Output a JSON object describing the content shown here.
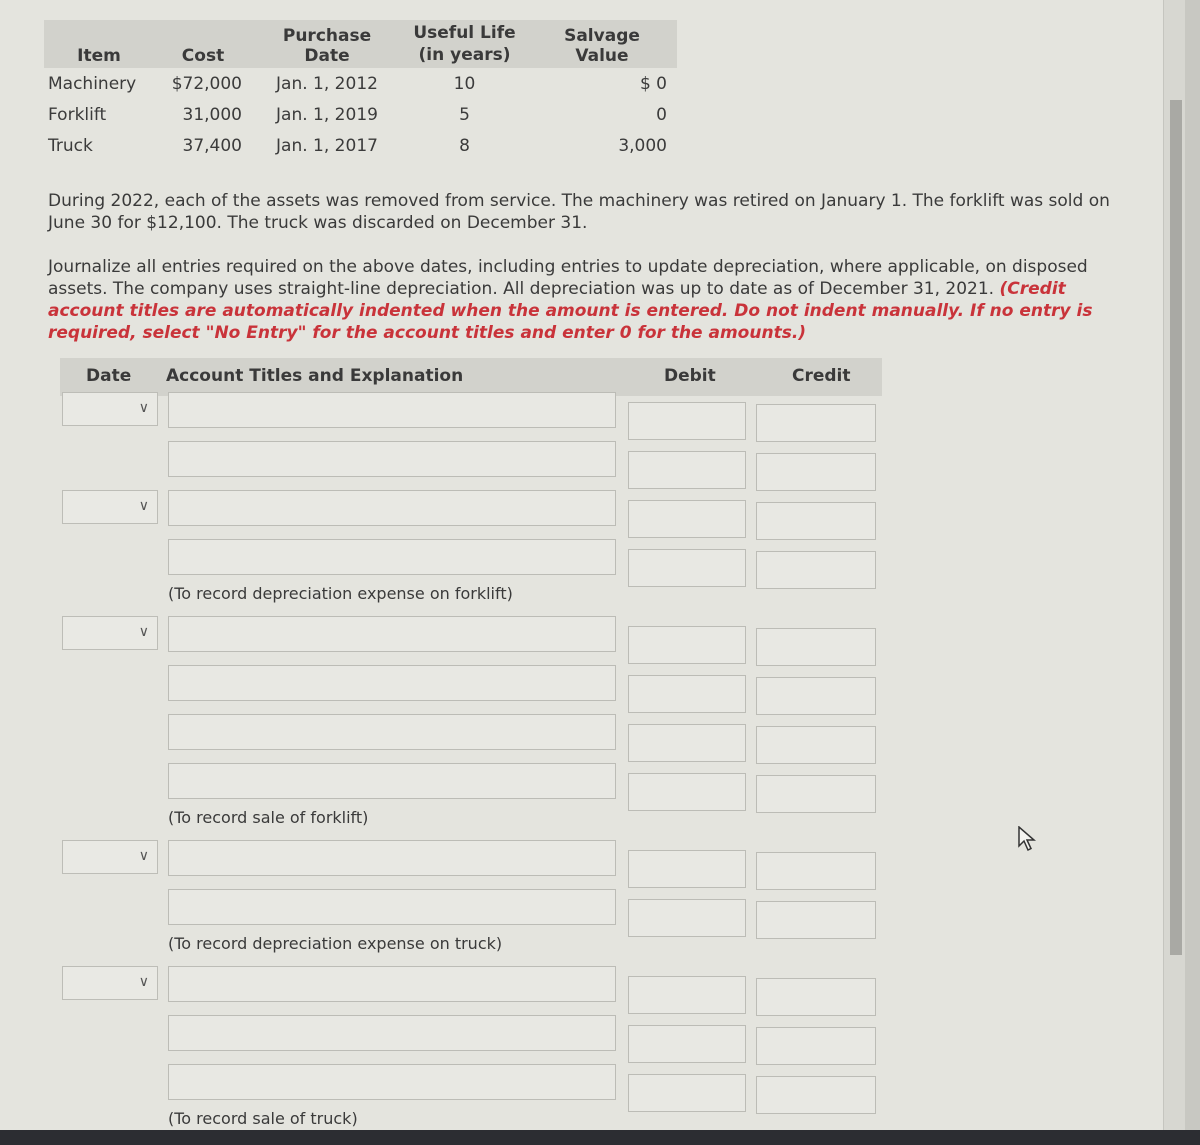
{
  "asset_table": {
    "headers": {
      "item": "Item",
      "cost": "Cost",
      "purchase_date": "Purchase Date",
      "useful_life_line1": "Useful Life",
      "useful_life_line2": "(in years)",
      "salvage_value": "Salvage Value"
    },
    "rows": [
      {
        "item": "Machinery",
        "cost": "$72,000",
        "purchase_date": "Jan. 1, 2012",
        "useful_life": "10",
        "salvage_value": "$ 0"
      },
      {
        "item": "Forklift",
        "cost": "31,000",
        "purchase_date": "Jan. 1, 2019",
        "useful_life": "5",
        "salvage_value": "0"
      },
      {
        "item": "Truck",
        "cost": "37,400",
        "purchase_date": "Jan. 1, 2017",
        "useful_life": "8",
        "salvage_value": "3,000"
      }
    ]
  },
  "paragraphs": {
    "scenario": "During 2022, each of the assets was removed from service. The machinery was retired on January 1. The forklift was sold on June 30 for $12,100. The truck was discarded on December 31.",
    "instruction": "Journalize all entries required on the above dates, including entries to update depreciation, where applicable, on disposed assets. The company uses straight-line depreciation. All depreciation was up to date as of December 31, 2021.",
    "instruction_note": "(Credit account titles are automatically indented when the amount is entered. Do not indent manually. If no entry is required, select \"No Entry\" for the account titles and enter 0 for the amounts.)"
  },
  "journal": {
    "headers": {
      "date": "Date",
      "account": "Account Titles and Explanation",
      "debit": "Debit",
      "credit": "Credit"
    },
    "entries": [
      {
        "date": "",
        "lines": 2,
        "note": ""
      },
      {
        "date": "",
        "lines": 2,
        "note": "(To record depreciation expense on forklift)"
      },
      {
        "date": "",
        "lines": 4,
        "note": "(To record sale of forklift)"
      },
      {
        "date": "",
        "lines": 2,
        "note": "(To record depreciation expense on truck)"
      },
      {
        "date": "",
        "lines": 3,
        "note": "(To record sale of truck)"
      }
    ]
  },
  "icons": {
    "date_chevron": "chevron-down-icon",
    "cursor": "mouse-pointer-icon"
  },
  "colors": {
    "instruction_red": "#c9333a",
    "header_bg": "#d2d2cc"
  }
}
